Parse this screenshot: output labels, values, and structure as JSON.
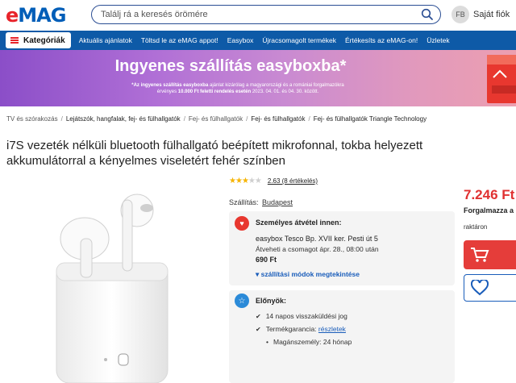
{
  "header": {
    "logo": "eMAG",
    "search_placeholder": "Találj rá a keresés örömére",
    "avatar_initials": "FB",
    "account_label": "Saját fiók"
  },
  "nav": {
    "categories_label": "Kategóriák",
    "links": [
      "Aktuális ajánlatok",
      "Töltsd le az eMAG appot!",
      "Easybox",
      "Újracsomagolt termékek",
      "Értékesíts az eMAG-on!",
      "Üzletek"
    ]
  },
  "banner": {
    "title": "Ingyenes szállítás easyboxba*",
    "note_line1_prefix": "*Az ingyenes szállítás easyboxba",
    "note_line1_rest": " ajánlat kizárólag a magyarországi és a romániai forgalmazókra",
    "note_line2_prefix": "érvényes ",
    "note_line2_bold": "10.000 Ft feletti rendelés esetén",
    "note_line2_rest": " 2023. 04. 01. és 04. 30. között."
  },
  "breadcrumb": [
    "TV és szórakozás",
    "Lejátszók, hangfalak, fej- és fülhallgatók",
    "Fej- és fülhallgatók",
    "Fej- és fülhallgatók",
    "Fej- és fülhallgatók Triangle Technology"
  ],
  "product": {
    "title": "i7S vezeték nélküli bluetooth fülhallgató beépített mikrofonnal, tokba helyezett akkumulátorral a kényelmes viseletért fehér színben",
    "rating_value": 2.63,
    "rating_text": "2.63 (8 értékelés)",
    "stars_filled": 3,
    "stars_total": 5
  },
  "shipping": {
    "label": "Szállítás:",
    "city": "Budapest",
    "pickup_heading": "Személyes átvétel innen:",
    "pickup_address": "easybox Tesco Bp. XVII ker. Pesti út 5",
    "pickup_time": "Átveheti a csomagot ápr. 28., 08:00 után",
    "pickup_price": "690 Ft",
    "more_options": "szállítási módok megtekintése"
  },
  "advantages": {
    "heading": "Előnyök:",
    "return": "14 napos visszaküldési jog",
    "warranty_label": "Termékgarancia:",
    "warranty_link": "részletek",
    "warranty_sub": "Magánszemély: 24 hónap"
  },
  "buy": {
    "price": "7.246 Ft",
    "seller": "Forgalmazza a",
    "stock": "raktáron"
  }
}
